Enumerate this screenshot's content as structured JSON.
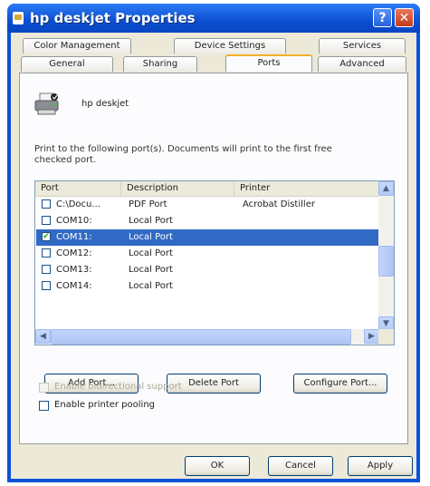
{
  "window": {
    "title": "hp deskjet Properties",
    "help_label": "?",
    "close_label": "✕"
  },
  "tabs_back": [
    "Color Management",
    "Device Settings",
    "Services"
  ],
  "tabs_front": [
    "General",
    "Sharing",
    "Ports",
    "Advanced"
  ],
  "active_tab": "Ports",
  "printer": {
    "name": "hp deskjet",
    "icon": "printer-icon"
  },
  "description": "Print to the following port(s). Documents will print to the first free checked port.",
  "ports_table": {
    "columns": [
      "Port",
      "Description",
      "Printer"
    ],
    "rows": [
      {
        "port": "C:\\Docu...",
        "description": "PDF Port",
        "printer": "Acrobat Distiller",
        "checked": false,
        "selected": false
      },
      {
        "port": "COM10:",
        "description": "Local Port",
        "printer": "",
        "checked": false,
        "selected": false
      },
      {
        "port": "COM11:",
        "description": "Local Port",
        "printer": "",
        "checked": true,
        "selected": true
      },
      {
        "port": "COM12:",
        "description": "Local Port",
        "printer": "",
        "checked": false,
        "selected": false
      },
      {
        "port": "COM13:",
        "description": "Local Port",
        "printer": "",
        "checked": false,
        "selected": false
      },
      {
        "port": "COM14:",
        "description": "Local Port",
        "printer": "",
        "checked": false,
        "selected": false
      }
    ]
  },
  "port_buttons": {
    "add": "Add Port...",
    "delete": "Delete Port",
    "configure": "Configure Port..."
  },
  "options": {
    "bidirectional": {
      "label": "Enable bidirectional support",
      "checked": false,
      "enabled": false
    },
    "pooling": {
      "label": "Enable printer pooling",
      "checked": false,
      "enabled": true
    }
  },
  "dialog_buttons": {
    "ok": "OK",
    "cancel": "Cancel",
    "apply": "Apply"
  }
}
